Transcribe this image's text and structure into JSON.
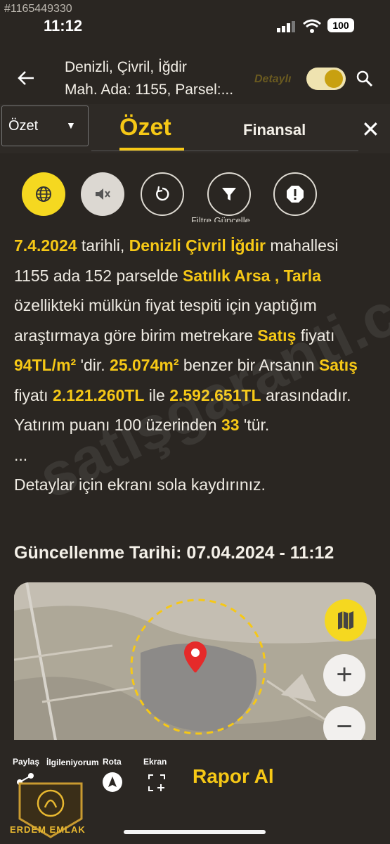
{
  "watermark_id": "#1165449330",
  "status_bar": {
    "time": "11:12",
    "battery": "100"
  },
  "header": {
    "title_line1": "Denizli, Çivril, İğdir",
    "title_line2": "Mah. Ada: 1155, Parsel:...",
    "detay_label": "Detaylı",
    "toggle_on": true
  },
  "tabs": {
    "dropdown_label": "Özet",
    "active": "Özet",
    "other": "Finansal"
  },
  "filter_label": "Filtre Güncelle",
  "paragraph": {
    "date": "7.4.2024",
    "t1": " tarihli, ",
    "location": "Denizli Çivril İğdir",
    "t2": " mahallesi 1155 ada 152  parselde ",
    "type": "Satılık Arsa , Tarla",
    "t3": " özellikteki mülkün fiyat tespiti için  yaptığım araştırmaya göre birim metrekare ",
    "satis1": "Satış",
    "t4": " fiyatı ",
    "unit_price": "94TL/m²",
    "t5": " 'dir.",
    "area": "25.074m²",
    "t6": " benzer bir Arsanın  ",
    "satis2": "Satış",
    "t7": " fiyatı ",
    "price_low": "2.121.260TL",
    "t8": " ile ",
    "price_high": "2.592.651TL",
    "t9": " arasındadır. Yatırım puanı 100 üzerinden ",
    "score": "33",
    "t10": " 'tür.",
    "ellipsis": "...",
    "details_hint": "Detaylar için ekranı sola kaydırınız."
  },
  "update": "Güncellenme Tarihi: 07.04.2024 - 11:12",
  "bg_watermark": "satışgaranti.com",
  "bottom": {
    "paylas": "Paylaş",
    "ilgileniyorum": "İlgileniyorum",
    "rota": "Rota",
    "ekran": "Ekran",
    "rapor": "Rapor Al",
    "logo": "ERDEM EMLAK"
  },
  "colors": {
    "accent": "#f6c816",
    "background": "#2a2622",
    "pin": "#e52a2a"
  }
}
